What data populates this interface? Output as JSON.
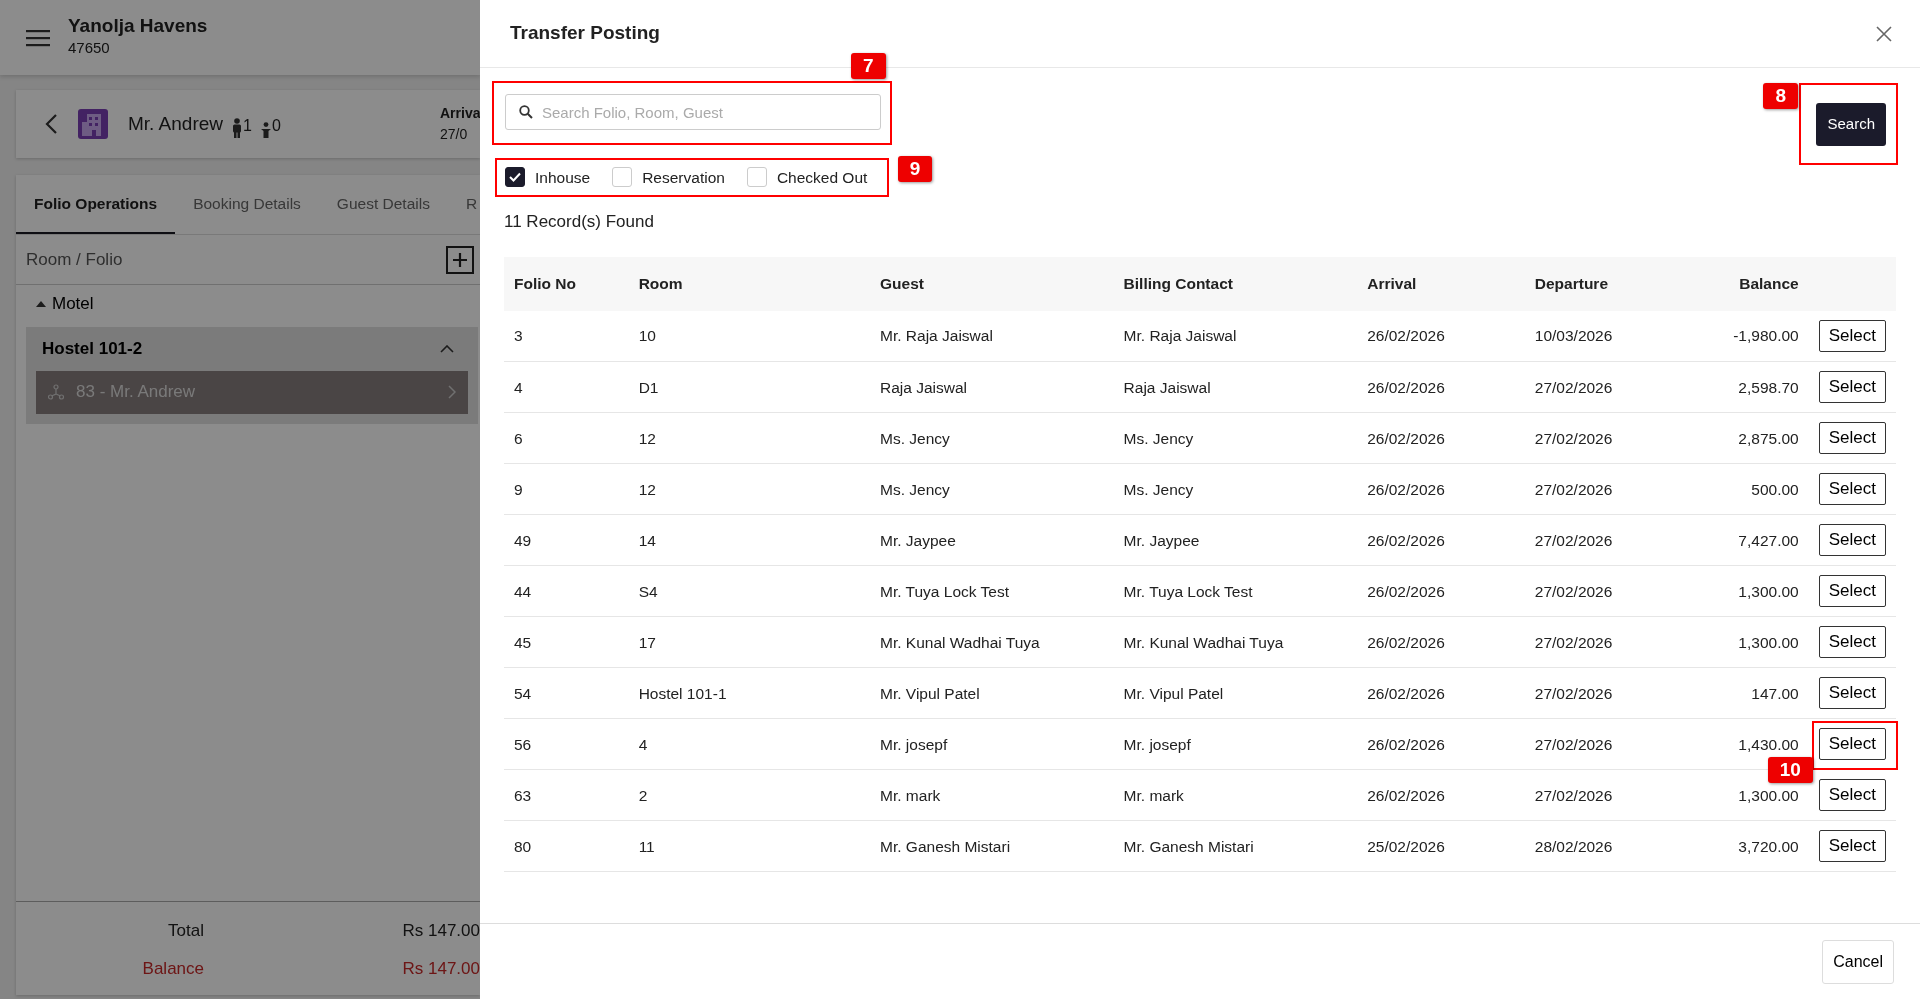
{
  "app_header": {
    "property_name": "Yanolja Havens",
    "property_code": "47650"
  },
  "guest_card": {
    "name": "Mr. Andrew",
    "adults": "1",
    "children": "0",
    "arrival_label": "Arriva",
    "arrival_date": "27/0"
  },
  "tabs": [
    {
      "label": "Folio Operations",
      "selected": true
    },
    {
      "label": "Booking Details",
      "selected": false
    },
    {
      "label": "Guest Details",
      "selected": false
    },
    {
      "label": "R",
      "selected": false
    }
  ],
  "folio_panel": {
    "title": "Room / Folio",
    "group": {
      "label": "Motel",
      "expanded": true,
      "rooms": [
        {
          "label": "Hostel 101-2",
          "expanded": true,
          "folios": [
            {
              "label": "83 - Mr. Andrew",
              "selected": true
            }
          ]
        }
      ]
    }
  },
  "totals": [
    {
      "label": "Total",
      "value": "Rs 147.00",
      "kind": "normal"
    },
    {
      "label": "Balance",
      "value": "Rs 147.00",
      "kind": "due"
    }
  ],
  "modal": {
    "title": "Transfer Posting",
    "search": {
      "placeholder": "Search Folio, Room, Guest",
      "callout": "7"
    },
    "search_button": {
      "label": "Search",
      "callout": "8"
    },
    "filters": {
      "callout": "9",
      "items": [
        {
          "label": "Inhouse",
          "checked": true
        },
        {
          "label": "Reservation",
          "checked": false
        },
        {
          "label": "Checked Out",
          "checked": false
        }
      ]
    },
    "record_count": "11 Record(s) Found",
    "table": {
      "columns": [
        "Folio No",
        "Room",
        "Guest",
        "Billing Contact",
        "Arrival",
        "Departure",
        "Balance"
      ],
      "rows": [
        {
          "cells": [
            "3",
            "10",
            "Mr. Raja Jaiswal",
            "Mr. Raja Jaiswal",
            "26/02/2026",
            "10/03/2026",
            "-1,980.00"
          ],
          "action": "Select"
        },
        {
          "cells": [
            "4",
            "D1",
            "Raja Jaiswal",
            "Raja Jaiswal",
            "26/02/2026",
            "27/02/2026",
            "2,598.70"
          ],
          "action": "Select"
        },
        {
          "cells": [
            "6",
            "12",
            "Ms. Jency",
            "Ms. Jency",
            "26/02/2026",
            "27/02/2026",
            "2,875.00"
          ],
          "action": "Select"
        },
        {
          "cells": [
            "9",
            "12",
            "Ms. Jency",
            "Ms. Jency",
            "26/02/2026",
            "27/02/2026",
            "500.00"
          ],
          "action": "Select"
        },
        {
          "cells": [
            "49",
            "14",
            "Mr. Jaypee",
            "Mr. Jaypee",
            "26/02/2026",
            "27/02/2026",
            "7,427.00"
          ],
          "action": "Select"
        },
        {
          "cells": [
            "44",
            "S4",
            "Mr. Tuya Lock Test",
            "Mr. Tuya Lock Test",
            "26/02/2026",
            "27/02/2026",
            "1,300.00"
          ],
          "action": "Select"
        },
        {
          "cells": [
            "45",
            "17",
            "Mr. Kunal Wadhai Tuya",
            "Mr. Kunal Wadhai Tuya",
            "26/02/2026",
            "27/02/2026",
            "1,300.00"
          ],
          "action": "Select"
        },
        {
          "cells": [
            "54",
            "Hostel 101-1",
            "Mr. Vipul Patel",
            "Mr. Vipul Patel",
            "26/02/2026",
            "27/02/2026",
            "147.00"
          ],
          "action": "Select"
        },
        {
          "cells": [
            "56",
            "4",
            "Mr. josepf",
            "Mr. josepf",
            "26/02/2026",
            "27/02/2026",
            "1,430.00"
          ],
          "action": "Select",
          "callout": "10"
        },
        {
          "cells": [
            "63",
            "2",
            "Mr. mark",
            "Mr. mark",
            "26/02/2026",
            "27/02/2026",
            "1,300.00"
          ],
          "action": "Select"
        },
        {
          "cells": [
            "80",
            "11",
            "Mr. Ganesh Mistari",
            "Mr. Ganesh Mistari",
            "25/02/2026",
            "28/02/2026",
            "3,720.00"
          ],
          "action": "Select"
        }
      ]
    },
    "footer_button": "Cancel"
  }
}
